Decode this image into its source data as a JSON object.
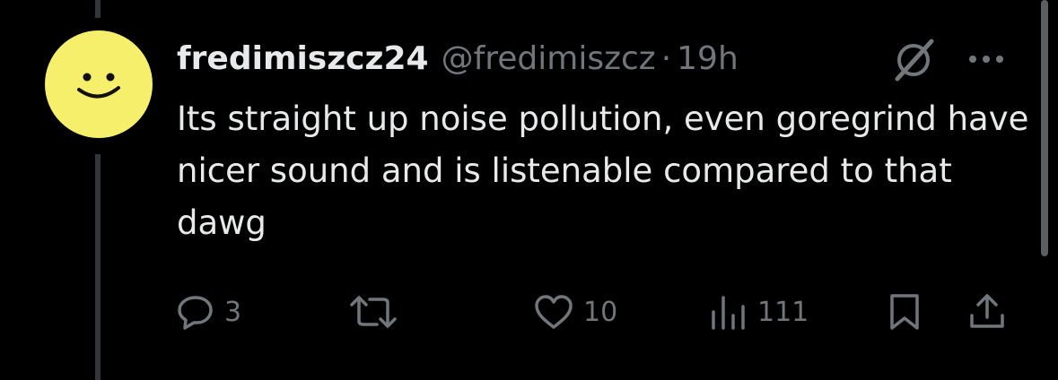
{
  "tweet": {
    "display_name": "fredimiszcz24",
    "handle": "@fredimiszcz",
    "separator": "·",
    "time": "19h",
    "text": "Its straight up noise pollution, even goregrind have nicer sound and is listenable compared to that dawg"
  },
  "actions": {
    "reply_count": "3",
    "retweet_count": "",
    "like_count": "10",
    "views_count": "111"
  },
  "icons": {
    "avatar": "smiley-face-avatar",
    "grok": "grok-icon",
    "more": "more-icon",
    "reply": "reply-icon",
    "retweet": "retweet-icon",
    "like": "heart-icon",
    "views": "views-icon",
    "bookmark": "bookmark-icon",
    "share": "share-icon"
  },
  "colors": {
    "background": "#000000",
    "text_primary": "#e7e9ea",
    "text_secondary": "#71767b",
    "avatar_yellow": "#f6ef6c",
    "thread_line": "#333639"
  }
}
